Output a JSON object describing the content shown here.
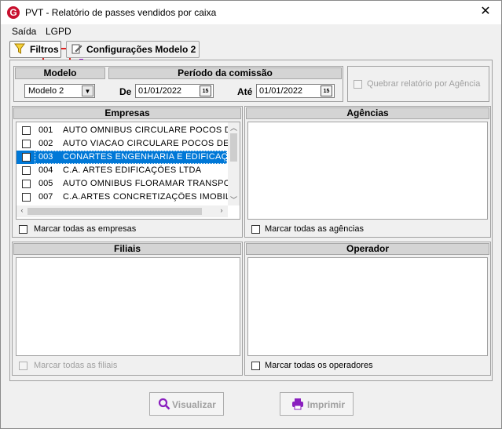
{
  "window": {
    "title": "PVT - Relatório de passes vendidos por caixa",
    "app_icon_letter": "G",
    "close_label": "✕"
  },
  "menu": {
    "saida": "Saída",
    "lgpd": "LGPD"
  },
  "tabs": [
    {
      "label": "Filtros",
      "icon": "funnel-icon",
      "active": true
    },
    {
      "label": "Configurações Modelo 2",
      "icon": "edit-document-icon",
      "active": false
    }
  ],
  "modelo": {
    "header": "Modelo",
    "value": "Modelo 2"
  },
  "periodo": {
    "header": "Período da comissão",
    "de_label": "De",
    "de_value": "01/01/2022",
    "ate_label": "Até",
    "ate_value": "01/01/2022",
    "calendar_label": "15"
  },
  "quebrar": {
    "label": "Quebrar relatório por Agência",
    "enabled": false
  },
  "empresas": {
    "header": "Empresas",
    "items": [
      {
        "code": "001",
        "name": "AUTO OMNIBUS CIRCULARE POCOS DE",
        "selected": false
      },
      {
        "code": "002",
        "name": "AUTO VIACAO CIRCULARE POCOS DE CA",
        "selected": false
      },
      {
        "code": "003",
        "name": "CONARTES ENGENHARIA E EDIFICAÇÕE",
        "selected": true
      },
      {
        "code": "004",
        "name": "C.A. ARTES EDIFICAÇÕES LTDA",
        "selected": false
      },
      {
        "code": "005",
        "name": "AUTO OMNIBUS FLORAMAR TRANSPOR",
        "selected": false
      },
      {
        "code": "007",
        "name": "C.A.ARTES CONCRETIZAÇÕES IMOBILIAF",
        "selected": false
      }
    ],
    "mark_all": "Marcar todas as empresas"
  },
  "agencias": {
    "header": "Agências",
    "mark_all": "Marcar todas as agências"
  },
  "filiais": {
    "header": "Filiais",
    "mark_all": "Marcar todas as filiais",
    "enabled": false
  },
  "operador": {
    "header": "Operador",
    "mark_all": "Marcar todas os operadores"
  },
  "buttons": {
    "visualizar": "Visualizar",
    "imprimir": "Imprimir"
  },
  "colors": {
    "selection": "#0078d7",
    "lgpd_highlight": "#e02020",
    "monitor_icon": "#a020d0",
    "app_icon": "#c8102e",
    "button_icon": "#8a1fbf"
  }
}
